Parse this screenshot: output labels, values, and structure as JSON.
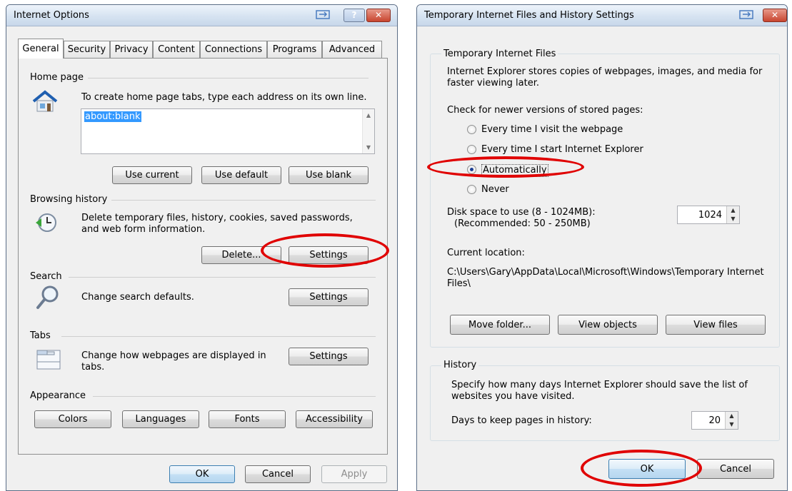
{
  "left_dialog": {
    "title": "Internet Options",
    "tabs": [
      "General",
      "Security",
      "Privacy",
      "Content",
      "Connections",
      "Programs",
      "Advanced"
    ],
    "home_page": {
      "label": "Home page",
      "instruction": "To create home page tabs, type each address on its own line.",
      "value": "about:blank",
      "use_current": "Use current",
      "use_default": "Use default",
      "use_blank": "Use blank"
    },
    "browsing_history": {
      "label": "Browsing history",
      "desc": "Delete temporary files, history, cookies, saved passwords, and web form information.",
      "delete": "Delete...",
      "settings": "Settings"
    },
    "search": {
      "label": "Search",
      "desc": "Change search defaults.",
      "settings": "Settings"
    },
    "tabs_section": {
      "label": "Tabs",
      "desc": "Change how webpages are displayed in tabs.",
      "settings": "Settings"
    },
    "appearance": {
      "label": "Appearance",
      "colors": "Colors",
      "languages": "Languages",
      "fonts": "Fonts",
      "accessibility": "Accessibility"
    },
    "footer": {
      "ok": "OK",
      "cancel": "Cancel",
      "apply": "Apply"
    },
    "help_glyph": "?",
    "close_glyph": "✕"
  },
  "right_dialog": {
    "title": "Temporary Internet Files and History Settings",
    "tif": {
      "label": "Temporary Internet Files",
      "desc": "Internet Explorer stores copies of webpages, images, and media for faster viewing later.",
      "check_label": "Check for newer versions of stored pages:",
      "options": [
        "Every time I visit the webpage",
        "Every time I start Internet Explorer",
        "Automatically",
        "Never"
      ],
      "selected": "Automatically",
      "disk_label": "Disk space to use (8 - 1024MB):",
      "disk_recommended": "(Recommended: 50 - 250MB)",
      "disk_value": "1024",
      "current_location_label": "Current location:",
      "current_location": "C:\\Users\\Gary\\AppData\\Local\\Microsoft\\Windows\\Temporary Internet Files\\",
      "move_folder": "Move folder...",
      "view_objects": "View objects",
      "view_files": "View files"
    },
    "history": {
      "label": "History",
      "desc": "Specify how many days Internet Explorer should save the list of websites you have visited.",
      "days_label": "Days to keep pages in history:",
      "days_value": "20"
    },
    "footer": {
      "ok": "OK",
      "cancel": "Cancel"
    },
    "close_glyph": "✕"
  },
  "accent_colors": {
    "highlight_ellipse": "#e00000",
    "selection": "#3399ff"
  }
}
